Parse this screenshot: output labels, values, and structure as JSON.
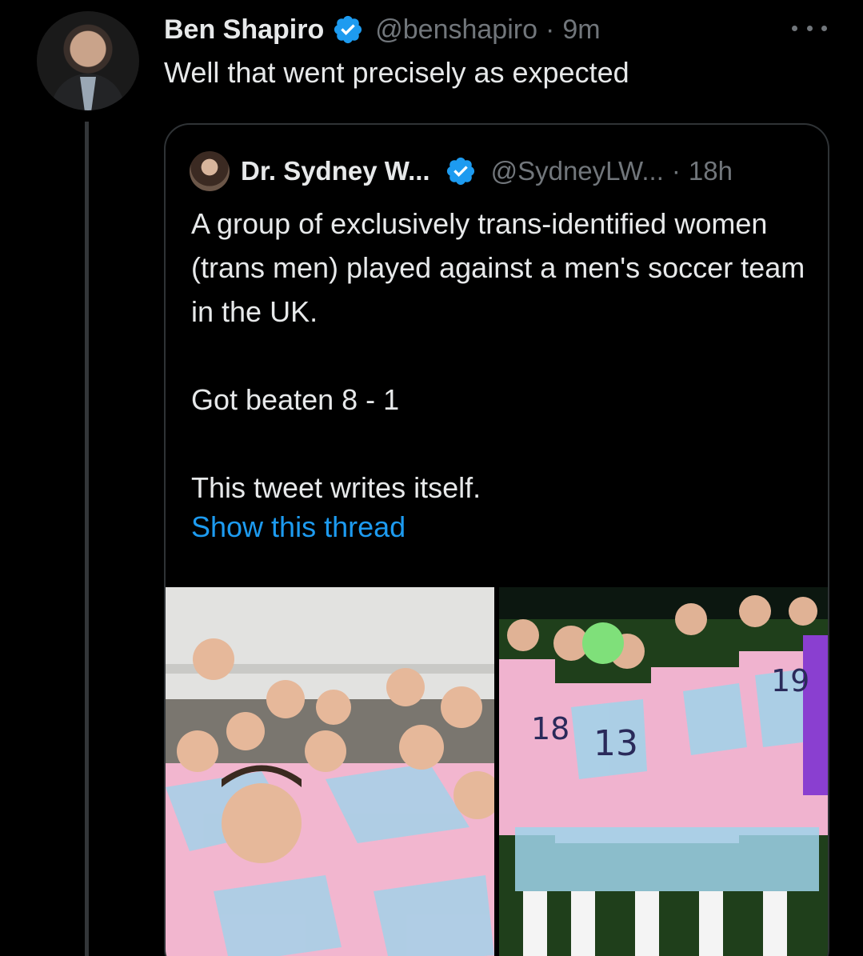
{
  "tweet": {
    "author_name": "Ben Shapiro",
    "handle": "@benshapiro",
    "separator": "·",
    "time": "9m",
    "text": "Well that went precisely as expected"
  },
  "quoted": {
    "author_name": "Dr. Sydney W...",
    "handle": "@SydneyLW...",
    "separator": "·",
    "time": "18h",
    "paragraphs": [
      "A group of exclusively trans-identified women (trans men) played against a men's soccer team in the UK.",
      "Got beaten 8 - 1",
      "This tweet writes itself."
    ],
    "show_thread": "Show this thread"
  },
  "icons": {
    "verified": "verified-badge-icon",
    "more": "more-horizontal-icon"
  },
  "colors": {
    "background": "#000000",
    "text": "#e7e9ea",
    "muted": "#71767b",
    "link": "#1d9bf0",
    "verified": "#1d9bf0",
    "border": "#2f3336"
  }
}
